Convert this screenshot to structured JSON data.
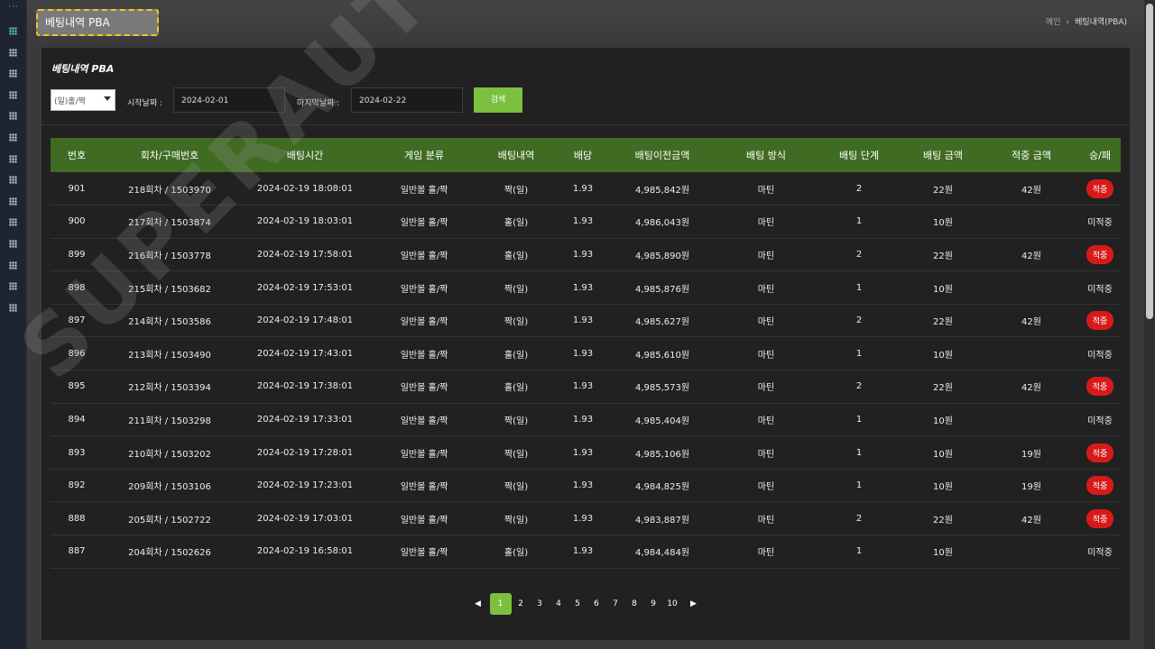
{
  "page": {
    "title_box": "베팅내역 PBA",
    "breadcrumb": {
      "home": "메인",
      "separator": "›",
      "current": "베팅내역(PBA)"
    },
    "card_title": "베팅내역 PBA"
  },
  "filters": {
    "type_value": "(일)홀/짝",
    "start_label": "시작날짜 :",
    "start_value": "2024-02-01",
    "end_label": "마지막날짜 :",
    "end_value": "2024-02-22",
    "search_label": "검색"
  },
  "table": {
    "headers": [
      "번호",
      "회차/구매번호",
      "배팅시간",
      "게임 분류",
      "배팅내역",
      "배당",
      "배팅이전금액",
      "배팅 방식",
      "배팅 단계",
      "배팅 금액",
      "적중 금액",
      "승/패"
    ],
    "rows": [
      {
        "no": "901",
        "round": "218회차 / 1503970",
        "time": "2024-02-19 18:08:01",
        "game": "일반볼 홀/짝",
        "pick": "짝(일)",
        "pick_color": "red",
        "odds": "1.93",
        "before": "4,985,842원",
        "method": "마틴",
        "step": "2",
        "amount": "22원",
        "win_amount": "42원",
        "result": "적중",
        "result_badge": true
      },
      {
        "no": "900",
        "round": "217회차 / 1503874",
        "time": "2024-02-19 18:03:01",
        "game": "일반볼 홀/짝",
        "pick": "홀(일)",
        "pick_color": "blue",
        "odds": "1.93",
        "before": "4,986,043원",
        "method": "마틴",
        "step": "1",
        "amount": "10원",
        "win_amount": "",
        "result": "미적중",
        "result_badge": false
      },
      {
        "no": "899",
        "round": "216회차 / 1503778",
        "time": "2024-02-19 17:58:01",
        "game": "일반볼 홀/짝",
        "pick": "홀(일)",
        "pick_color": "blue",
        "odds": "1.93",
        "before": "4,985,890원",
        "method": "마틴",
        "step": "2",
        "amount": "22원",
        "win_amount": "42원",
        "result": "적중",
        "result_badge": true
      },
      {
        "no": "898",
        "round": "215회차 / 1503682",
        "time": "2024-02-19 17:53:01",
        "game": "일반볼 홀/짝",
        "pick": "짝(일)",
        "pick_color": "red",
        "odds": "1.93",
        "before": "4,985,876원",
        "method": "마틴",
        "step": "1",
        "amount": "10원",
        "win_amount": "",
        "result": "미적중",
        "result_badge": false
      },
      {
        "no": "897",
        "round": "214회차 / 1503586",
        "time": "2024-02-19 17:48:01",
        "game": "일반볼 홀/짝",
        "pick": "짝(일)",
        "pick_color": "red",
        "odds": "1.93",
        "before": "4,985,627원",
        "method": "마틴",
        "step": "2",
        "amount": "22원",
        "win_amount": "42원",
        "result": "적중",
        "result_badge": true
      },
      {
        "no": "896",
        "round": "213회차 / 1503490",
        "time": "2024-02-19 17:43:01",
        "game": "일반볼 홀/짝",
        "pick": "홀(일)",
        "pick_color": "blue",
        "odds": "1.93",
        "before": "4,985,610원",
        "method": "마틴",
        "step": "1",
        "amount": "10원",
        "win_amount": "",
        "result": "미적중",
        "result_badge": false
      },
      {
        "no": "895",
        "round": "212회차 / 1503394",
        "time": "2024-02-19 17:38:01",
        "game": "일반볼 홀/짝",
        "pick": "홀(일)",
        "pick_color": "blue",
        "odds": "1.93",
        "before": "4,985,573원",
        "method": "마틴",
        "step": "2",
        "amount": "22원",
        "win_amount": "42원",
        "result": "적중",
        "result_badge": true
      },
      {
        "no": "894",
        "round": "211회차 / 1503298",
        "time": "2024-02-19 17:33:01",
        "game": "일반볼 홀/짝",
        "pick": "짝(일)",
        "pick_color": "red",
        "odds": "1.93",
        "before": "4,985,404원",
        "method": "마틴",
        "step": "1",
        "amount": "10원",
        "win_amount": "",
        "result": "미적중",
        "result_badge": false
      },
      {
        "no": "893",
        "round": "210회차 / 1503202",
        "time": "2024-02-19 17:28:01",
        "game": "일반볼 홀/짝",
        "pick": "짝(일)",
        "pick_color": "red",
        "odds": "1.93",
        "before": "4,985,106원",
        "method": "마틴",
        "step": "1",
        "amount": "10원",
        "win_amount": "19원",
        "result": "적중",
        "result_badge": true
      },
      {
        "no": "892",
        "round": "209회차 / 1503106",
        "time": "2024-02-19 17:23:01",
        "game": "일반볼 홀/짝",
        "pick": "짝(일)",
        "pick_color": "red",
        "odds": "1.93",
        "before": "4,984,825원",
        "method": "마틴",
        "step": "1",
        "amount": "10원",
        "win_amount": "19원",
        "result": "적중",
        "result_badge": true
      },
      {
        "no": "888",
        "round": "205회차 / 1502722",
        "time": "2024-02-19 17:03:01",
        "game": "일반볼 홀/짝",
        "pick": "짝(일)",
        "pick_color": "red",
        "odds": "1.93",
        "before": "4,983,887원",
        "method": "마틴",
        "step": "2",
        "amount": "22원",
        "win_amount": "42원",
        "result": "적중",
        "result_badge": true
      },
      {
        "no": "887",
        "round": "204회차 / 1502626",
        "time": "2024-02-19 16:58:01",
        "game": "일반볼 홀/짝",
        "pick": "홀(일)",
        "pick_color": "blue",
        "odds": "1.93",
        "before": "4,984,484원",
        "method": "마틴",
        "step": "1",
        "amount": "10원",
        "win_amount": "",
        "result": "미적중",
        "result_badge": false
      }
    ]
  },
  "pagination": {
    "prev": "◀",
    "next": "▶",
    "pages": [
      "1",
      "2",
      "3",
      "4",
      "5",
      "6",
      "7",
      "8",
      "9",
      "10"
    ],
    "active": "1"
  },
  "watermark": "SUPERAUTO",
  "sidebar": {
    "top_dots": "···",
    "icon": "grid-icon",
    "icon_count": 14,
    "active_index": 0
  },
  "colors": {
    "accent_green": "#7cc040",
    "header_green": "#3f6b23",
    "pick_red": "#ff4b2b",
    "pick_blue": "#3b8eea",
    "badge_red": "#d61a1a",
    "title_border": "#f3c623"
  }
}
